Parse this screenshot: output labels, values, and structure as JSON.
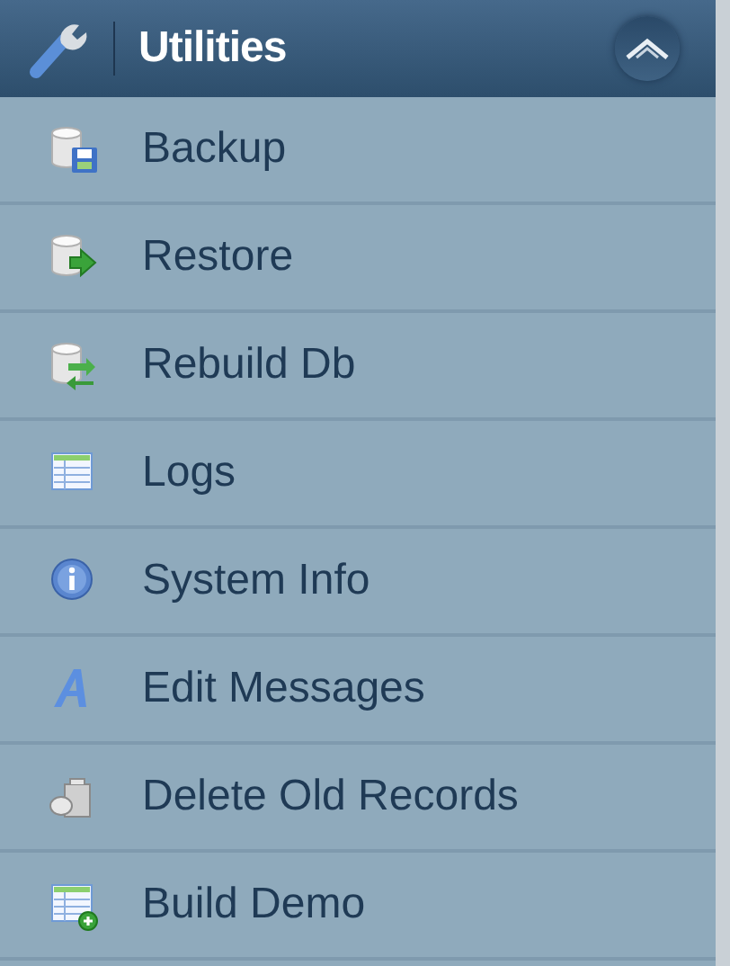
{
  "panel": {
    "title": "Utilities",
    "expanded": true
  },
  "items": [
    {
      "label": "Backup",
      "kind": "backup"
    },
    {
      "label": "Restore",
      "kind": "restore"
    },
    {
      "label": "Rebuild Db",
      "kind": "rebuild"
    },
    {
      "label": "Logs",
      "kind": "logs"
    },
    {
      "label": "System Info",
      "kind": "info"
    },
    {
      "label": "Edit Messages",
      "kind": "edit"
    },
    {
      "label": "Delete Old Records",
      "kind": "delete"
    },
    {
      "label": "Build Demo",
      "kind": "demo"
    }
  ]
}
